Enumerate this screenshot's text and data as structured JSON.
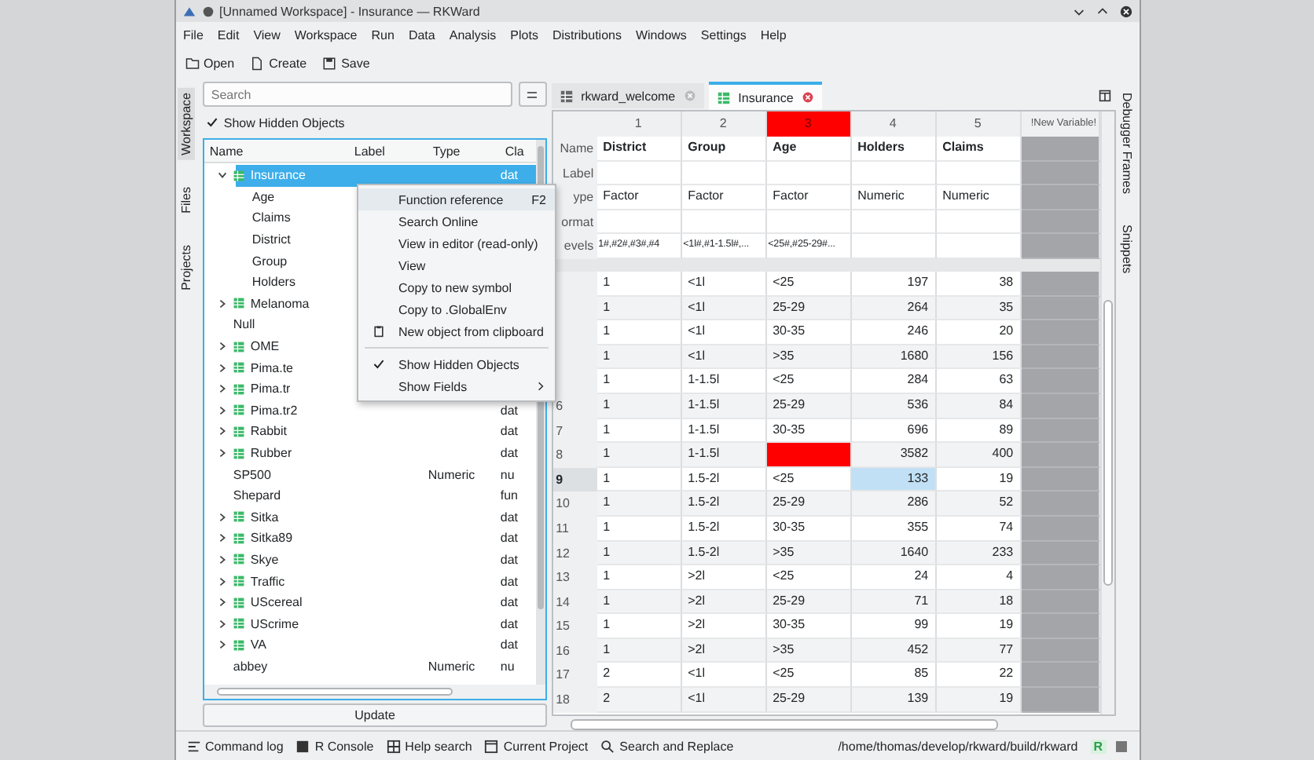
{
  "window": {
    "title": "[Unnamed Workspace] - Insurance — RKWard"
  },
  "menubar": [
    "File",
    "Edit",
    "View",
    "Workspace",
    "Run",
    "Data",
    "Analysis",
    "Plots",
    "Distributions",
    "Windows",
    "Settings",
    "Help"
  ],
  "toolbar": [
    {
      "label": "Open",
      "kind": "open"
    },
    {
      "label": "Create",
      "kind": "create"
    },
    {
      "label": "Save",
      "kind": "save"
    }
  ],
  "left_tabs": [
    {
      "label": "Workspace",
      "selected": true
    },
    {
      "label": "Files",
      "selected": false
    },
    {
      "label": "Projects",
      "selected": false
    }
  ],
  "workspace": {
    "search": {
      "placeholder": "Search"
    },
    "show_hidden": {
      "label": "Show Hidden Objects",
      "checked": true
    },
    "columns": [
      "Name",
      "Label",
      "Type",
      "Cla"
    ],
    "objects": [
      {
        "name": "Insurance",
        "kind": "frame",
        "expanded": true,
        "selected": true,
        "class": "dat",
        "children": [
          {
            "name": "Age",
            "kind": "plain",
            "selected": false
          },
          {
            "name": "Claims",
            "kind": "plain",
            "selected": false
          },
          {
            "name": "District",
            "kind": "plain",
            "selected": false
          },
          {
            "name": "Group",
            "kind": "plain",
            "selected": false
          },
          {
            "name": "Holders",
            "kind": "plain",
            "selected": false
          }
        ]
      },
      {
        "name": "Melanoma",
        "kind": "frame",
        "expanded": false,
        "selected": false
      },
      {
        "name": "Null",
        "kind": "plain",
        "selected": false
      },
      {
        "name": "OME",
        "kind": "frame",
        "expanded": false,
        "selected": false
      },
      {
        "name": "Pima.te",
        "kind": "frame",
        "expanded": false,
        "selected": false
      },
      {
        "name": "Pima.tr",
        "kind": "frame",
        "expanded": false,
        "selected": false
      },
      {
        "name": "Pima.tr2",
        "kind": "frame",
        "expanded": false,
        "selected": false,
        "class": "dat"
      },
      {
        "name": "Rabbit",
        "kind": "frame",
        "expanded": false,
        "selected": false,
        "class": "dat"
      },
      {
        "name": "Rubber",
        "kind": "frame",
        "expanded": false,
        "selected": false,
        "class": "dat"
      },
      {
        "name": "SP500",
        "kind": "plain",
        "selected": false,
        "type": "Numeric",
        "class": "nu"
      },
      {
        "name": "Shepard",
        "kind": "plain",
        "selected": false,
        "class": "fun"
      },
      {
        "name": "Sitka",
        "kind": "frame",
        "expanded": false,
        "selected": false,
        "class": "dat"
      },
      {
        "name": "Sitka89",
        "kind": "frame",
        "expanded": false,
        "selected": false,
        "class": "dat"
      },
      {
        "name": "Skye",
        "kind": "frame",
        "expanded": false,
        "selected": false,
        "class": "dat"
      },
      {
        "name": "Traffic",
        "kind": "frame",
        "expanded": false,
        "selected": false,
        "class": "dat"
      },
      {
        "name": "UScereal",
        "kind": "frame",
        "expanded": false,
        "selected": false,
        "class": "dat"
      },
      {
        "name": "UScrime",
        "kind": "frame",
        "expanded": false,
        "selected": false,
        "class": "dat"
      },
      {
        "name": "VA",
        "kind": "frame",
        "expanded": false,
        "selected": false,
        "class": "dat"
      },
      {
        "name": "abbey",
        "kind": "plain",
        "selected": false,
        "type": "Numeric",
        "class": "nu"
      }
    ],
    "update_button": "Update"
  },
  "context_menu": [
    {
      "kind": "action",
      "label": "Function reference",
      "shortcut": "F2",
      "selected": true
    },
    {
      "kind": "action",
      "label": "Search Online",
      "selected": false
    },
    {
      "kind": "action",
      "label": "View in editor (read-only)",
      "selected": false
    },
    {
      "kind": "action",
      "label": "View",
      "selected": false
    },
    {
      "kind": "action",
      "label": "Copy to new symbol",
      "selected": false
    },
    {
      "kind": "action",
      "label": "Copy to .GlobalEnv",
      "selected": false
    },
    {
      "kind": "icon_action",
      "label": "New object from clipboard",
      "selected": false
    },
    {
      "kind": "separator"
    },
    {
      "kind": "check",
      "label": "Show Hidden Objects",
      "checked": true,
      "selected": false
    },
    {
      "kind": "submenu",
      "label": "Show Fields",
      "selected": false
    }
  ],
  "editor": {
    "tabs": [
      {
        "label": "rkward_welcome",
        "selected": false
      },
      {
        "label": "Insurance",
        "selected": true
      }
    ],
    "columns": [
      {
        "label": "1",
        "invalid": false,
        "numeric": false
      },
      {
        "label": "2",
        "invalid": false,
        "numeric": false
      },
      {
        "label": "3",
        "invalid": true,
        "numeric": false
      },
      {
        "label": "4",
        "invalid": false,
        "numeric": true
      },
      {
        "label": "5",
        "invalid": false,
        "numeric": true
      }
    ],
    "new_column": "!New Variable!",
    "meta_rows": [
      {
        "label": "Name",
        "kind": "name",
        "values": [
          "District",
          "Group",
          "Age",
          "Holders",
          "Claims"
        ]
      },
      {
        "label": "Label",
        "kind": "plain",
        "values": []
      },
      {
        "label": "ype",
        "kind": "plain",
        "values": [
          "Factor",
          "Factor",
          "Factor",
          "Numeric",
          "Numeric"
        ]
      },
      {
        "label": "ormat",
        "kind": "plain",
        "values": []
      },
      {
        "label": "evels",
        "kind": "plain",
        "values": [
          "1#,#2#,#3#,#4",
          "<1l#,#1-1.5l#,...",
          "<25#,#25-29#..."
        ]
      }
    ],
    "rows": [
      {
        "current": false,
        "cells": [
          "1",
          "<1l",
          "<25",
          "197",
          "38"
        ]
      },
      {
        "current": false,
        "cells": [
          "1",
          "<1l",
          "25-29",
          "264",
          "35"
        ]
      },
      {
        "current": false,
        "cells": [
          "1",
          "<1l",
          "30-35",
          "246",
          "20"
        ]
      },
      {
        "current": false,
        "cells": [
          "1",
          "<1l",
          ">35",
          "1680",
          "156"
        ]
      },
      {
        "current": false,
        "cells": [
          "1",
          "1-1.5l",
          "<25",
          "284",
          "63"
        ]
      },
      {
        "num": "6",
        "current": false,
        "cells": [
          "1",
          "1-1.5l",
          "25-29",
          "536",
          "84"
        ]
      },
      {
        "num": "7",
        "current": false,
        "cells": [
          "1",
          "1-1.5l",
          "30-35",
          "696",
          "89"
        ]
      },
      {
        "num": "8",
        "current": false,
        "cells": [
          "1",
          "1-1.5l",
          {
            "invalid": true
          },
          "3582",
          "400"
        ]
      },
      {
        "num": "9",
        "current": true,
        "cells": [
          "1",
          "1.5-2l",
          "<25",
          {
            "text": "133",
            "selected": true
          },
          "19"
        ]
      },
      {
        "num": "10",
        "current": false,
        "cells": [
          "1",
          "1.5-2l",
          "25-29",
          "286",
          "52"
        ]
      },
      {
        "num": "11",
        "current": false,
        "cells": [
          "1",
          "1.5-2l",
          "30-35",
          "355",
          "74"
        ]
      },
      {
        "num": "12",
        "current": false,
        "cells": [
          "1",
          "1.5-2l",
          ">35",
          "1640",
          "233"
        ]
      },
      {
        "num": "13",
        "current": false,
        "cells": [
          "1",
          ">2l",
          "<25",
          "24",
          "4"
        ]
      },
      {
        "num": "14",
        "current": false,
        "cells": [
          "1",
          ">2l",
          "25-29",
          "71",
          "18"
        ]
      },
      {
        "num": "15",
        "current": false,
        "cells": [
          "1",
          ">2l",
          "30-35",
          "99",
          "19"
        ]
      },
      {
        "num": "16",
        "current": false,
        "cells": [
          "1",
          ">2l",
          ">35",
          "452",
          "77"
        ]
      },
      {
        "num": "17",
        "current": false,
        "cells": [
          "2",
          "<1l",
          "<25",
          "85",
          "22"
        ]
      },
      {
        "num": "18",
        "current": false,
        "cells": [
          "2",
          "<1l",
          "25-29",
          "139",
          "19"
        ]
      }
    ]
  },
  "right_tabs": [
    "Debugger Frames",
    "Snippets"
  ],
  "status_bar": {
    "items": [
      {
        "label": "Command log",
        "kind": "log"
      },
      {
        "label": "R Console",
        "kind": "console"
      },
      {
        "label": "Help search",
        "kind": "help"
      },
      {
        "label": "Current Project",
        "kind": "project"
      },
      {
        "label": "Search and Replace",
        "kind": "search"
      }
    ],
    "path": "/home/thomas/develop/rkward/build/rkward",
    "r_indicator": "R"
  }
}
